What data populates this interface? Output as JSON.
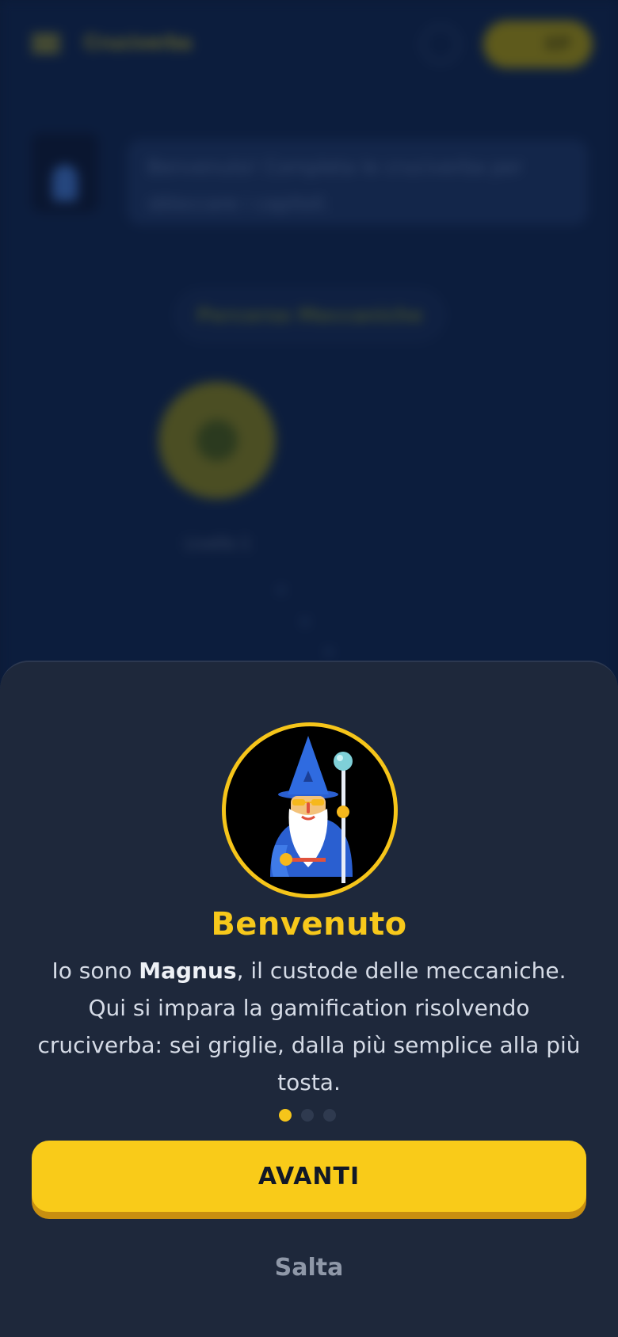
{
  "background_app": {
    "title": "Cruciverba",
    "xp_badge": "XP",
    "bubble_text": "Benvenuto! Completa le cruciverba per sbloccare i capitoli.",
    "pill_label": "Percorso Meccaniche",
    "node_label": "Livello 1"
  },
  "onboarding": {
    "mascot_name": "magnus-wizard",
    "title": "Benvenuto",
    "body_prefix": "Io sono ",
    "body_bold": "Magnus",
    "body_suffix": ", il custode delle meccaniche. Qui si impara la gamification risolvendo cruciverba: sei griglie, dalla più semplice alla più tosta.",
    "pager": {
      "total": 3,
      "current": 1
    },
    "next_label": "AVANTI",
    "skip_label": "Salta"
  },
  "colors": {
    "accent": "#f9cb19",
    "sheet_bg": "#1e283b",
    "page_bg": "#0c1d3d",
    "text": "#d5dbe6",
    "muted": "#8f98a8"
  }
}
